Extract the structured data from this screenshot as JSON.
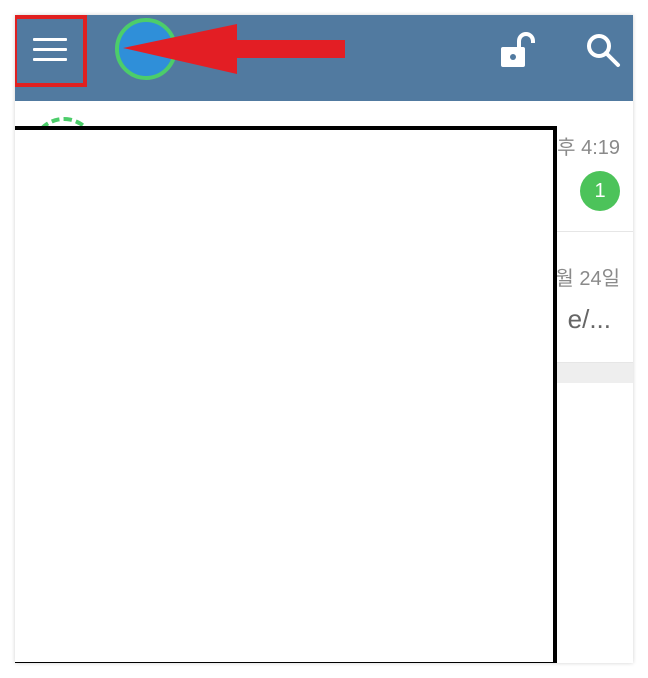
{
  "app": {
    "title": "",
    "appbar_color": "#517aa0",
    "accent_green": "#4ccd6a",
    "highlight_red": "#e02020"
  },
  "toolbar": {
    "menu_icon": "hamburger-menu-icon",
    "lock_icon": "unlock-icon",
    "search_icon": "search-icon"
  },
  "conversations": [
    {
      "time": "후 4:19",
      "unread": "1",
      "preview": ""
    },
    {
      "time": "월 24일",
      "unread": "",
      "preview": "e/..."
    }
  ]
}
